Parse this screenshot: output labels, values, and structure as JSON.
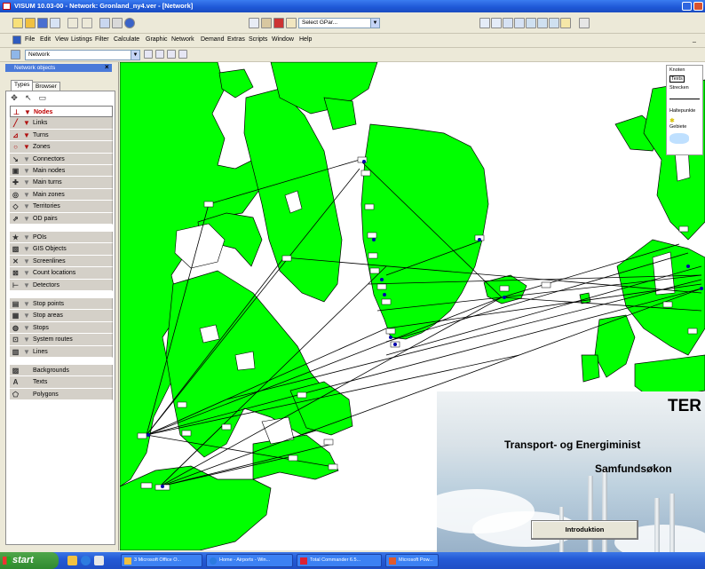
{
  "window": {
    "title": "VISUM 10.03-00 - Network: Gronland_ny4.ver - [Network]"
  },
  "toolbar": {
    "graphic_parameter_select": "Select GPar..."
  },
  "menu": {
    "items": [
      "File",
      "Edit",
      "View",
      "Listings",
      "Filter",
      "Calculate",
      "Graphic",
      "Network",
      "Demand",
      "Extras",
      "Scripts",
      "Window",
      "Help"
    ]
  },
  "subtoolbar": {
    "view_select": "Network"
  },
  "left_panel": {
    "title": "Network objects",
    "tabs": [
      "Types",
      "Browser"
    ],
    "groups": [
      {
        "items": [
          {
            "label": "Nodes",
            "icon": "node-icon",
            "selected": true,
            "filter_active": true
          },
          {
            "label": "Links",
            "icon": "link-icon",
            "filter_active": true
          },
          {
            "label": "Turns",
            "icon": "turn-icon",
            "filter_active": true
          },
          {
            "label": "Zones",
            "icon": "zone-icon",
            "filter_active": true
          },
          {
            "label": "Connectors",
            "icon": "connector-icon"
          },
          {
            "label": "Main nodes",
            "icon": "main-node-icon"
          },
          {
            "label": "Main turns",
            "icon": "main-turn-icon"
          },
          {
            "label": "Main zones",
            "icon": "main-zone-icon"
          },
          {
            "label": "Territories",
            "icon": "territory-icon"
          },
          {
            "label": "OD pairs",
            "icon": "od-pair-icon"
          }
        ]
      },
      {
        "items": [
          {
            "label": "POIs",
            "icon": "poi-icon"
          },
          {
            "label": "GIS Objects",
            "icon": "gis-icon"
          },
          {
            "label": "Screenlines",
            "icon": "screenline-icon"
          },
          {
            "label": "Count locations",
            "icon": "count-location-icon"
          },
          {
            "label": "Detectors",
            "icon": "detector-icon"
          }
        ]
      },
      {
        "items": [
          {
            "label": "Stop points",
            "icon": "stop-point-icon"
          },
          {
            "label": "Stop areas",
            "icon": "stop-area-icon"
          },
          {
            "label": "Stops",
            "icon": "stop-icon"
          },
          {
            "label": "System routes",
            "icon": "system-route-icon"
          },
          {
            "label": "Lines",
            "icon": "line-icon"
          }
        ]
      },
      {
        "items": [
          {
            "label": "Backgrounds",
            "icon": "background-icon"
          },
          {
            "label": "Texts",
            "icon": "text-icon"
          },
          {
            "label": "Polygons",
            "icon": "polygon-icon"
          }
        ]
      }
    ]
  },
  "map_legend": {
    "items": [
      "Knoten",
      "Texts",
      "Strecken",
      "Haltepunkte",
      "Gebiete"
    ]
  },
  "overlay": {
    "title": "TER",
    "line1": "Transport- og Energiminist",
    "line2": "Samfundsøkon",
    "button": "Introduktion"
  },
  "taskbar": {
    "start": "start",
    "items": [
      "3 Microsoft Office O...",
      "Home - Airports - Win...",
      "Total Commander 6.5...",
      "Microsoft Pow..."
    ]
  },
  "colors": {
    "land": "#00ff00",
    "water": "#ffffff",
    "routes": "#000000",
    "titlebar": "#1e57d6",
    "selected_item": "#c00000"
  }
}
